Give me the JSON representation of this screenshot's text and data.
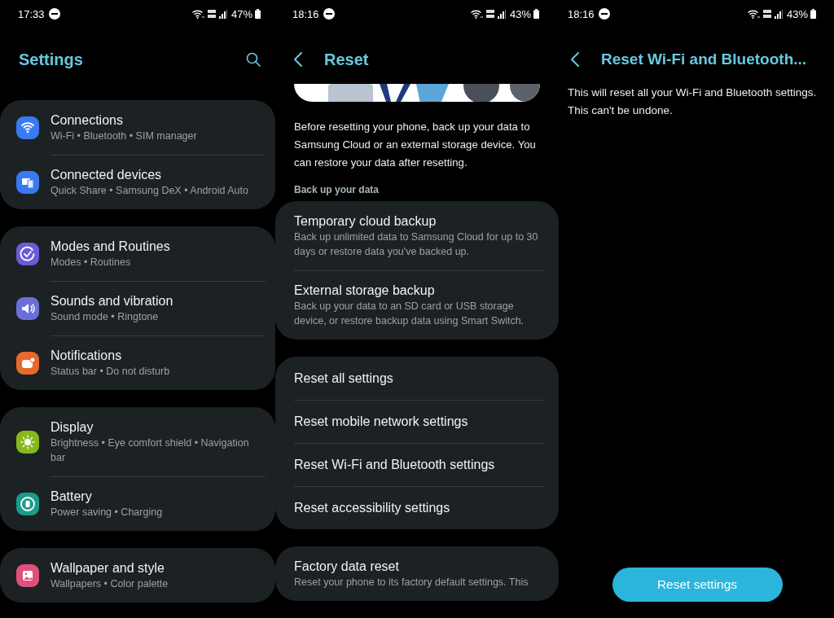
{
  "screens": [
    {
      "kind": "settings",
      "status_bar": {
        "time": "17:33",
        "battery": "47%"
      },
      "title": "Settings",
      "groups": [
        [
          {
            "title": "Connections",
            "subtitle": "Wi-Fi • Bluetooth • SIM manager",
            "color": "#3a7af0"
          },
          {
            "title": "Connected devices",
            "subtitle": "Quick Share • Samsung DeX • Android Auto",
            "color": "#3a7af0"
          }
        ],
        [
          {
            "title": "Modes and Routines",
            "subtitle": "Modes • Routines",
            "color": "#6a5bd8"
          },
          {
            "title": "Sounds and vibration",
            "subtitle": "Sound mode • Ringtone",
            "color": "#6a6fd8"
          },
          {
            "title": "Notifications",
            "subtitle": "Status bar • Do not disturb",
            "color": "#e8692c"
          }
        ],
        [
          {
            "title": "Display",
            "subtitle": "Brightness • Eye comfort shield • Navigation bar",
            "color": "#86b81e"
          },
          {
            "title": "Battery",
            "subtitle": "Power saving • Charging",
            "color": "#1a9c8c"
          }
        ],
        [
          {
            "title": "Wallpaper and style",
            "subtitle": "Wallpapers • Color palette",
            "color": "#e0507a"
          }
        ]
      ]
    },
    {
      "kind": "reset",
      "status_bar": {
        "time": "18:16",
        "battery": "43%"
      },
      "title": "Reset",
      "intro": "Before resetting your phone, back up your data to Samsung Cloud or an external storage device. You can restore your data after resetting.",
      "section": "Back up your data",
      "groups": [
        [
          {
            "title": "Temporary cloud backup",
            "subtitle": "Back up unlimited data to Samsung Cloud for up to 30 days or restore data you've backed up."
          },
          {
            "title": "External storage backup",
            "subtitle": "Back up your data to an SD card or USB storage device, or restore backup data using Smart Switch."
          }
        ],
        [
          {
            "title": "Reset all settings"
          },
          {
            "title": "Reset mobile network settings"
          },
          {
            "title": "Reset Wi-Fi and Bluetooth settings"
          },
          {
            "title": "Reset accessibility settings"
          }
        ],
        [
          {
            "title": "Factory data reset",
            "subtitle": "Reset your phone to its factory default settings. This"
          }
        ]
      ]
    },
    {
      "kind": "confirm",
      "status_bar": {
        "time": "18:16",
        "battery": "43%"
      },
      "title": "Reset Wi-Fi and Bluetooth...",
      "message": "This will reset all your Wi-Fi and Bluetooth settings. This can't be undone.",
      "button": "Reset settings"
    }
  ]
}
